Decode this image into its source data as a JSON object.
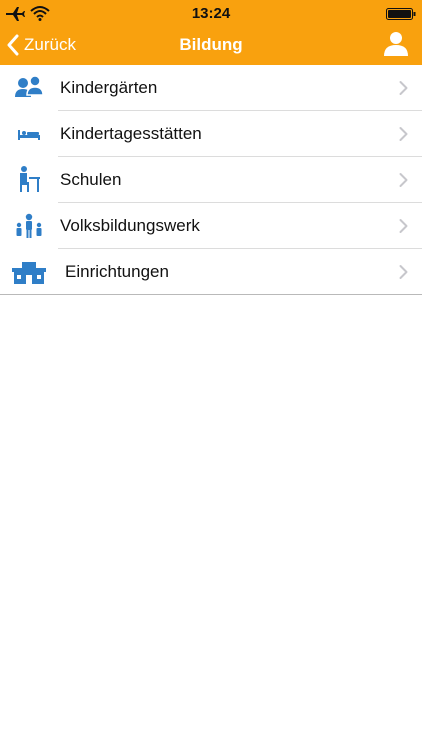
{
  "status_bar": {
    "time": "13:24"
  },
  "nav": {
    "back_label": "Zurück",
    "title": "Bildung"
  },
  "colors": {
    "accent": "#f9a10e",
    "icon_blue": "#2f7ec7",
    "chevron": "#c7c7cc"
  },
  "list": {
    "items": [
      {
        "label": "Kindergärten",
        "icon": "children-icon"
      },
      {
        "label": "Kindertagesstätten",
        "icon": "bed-icon"
      },
      {
        "label": "Schulen",
        "icon": "student-desk-icon"
      },
      {
        "label": "Volksbildungswerk",
        "icon": "people-group-icon"
      },
      {
        "label": "Einrichtungen",
        "icon": "building-icon"
      }
    ]
  }
}
